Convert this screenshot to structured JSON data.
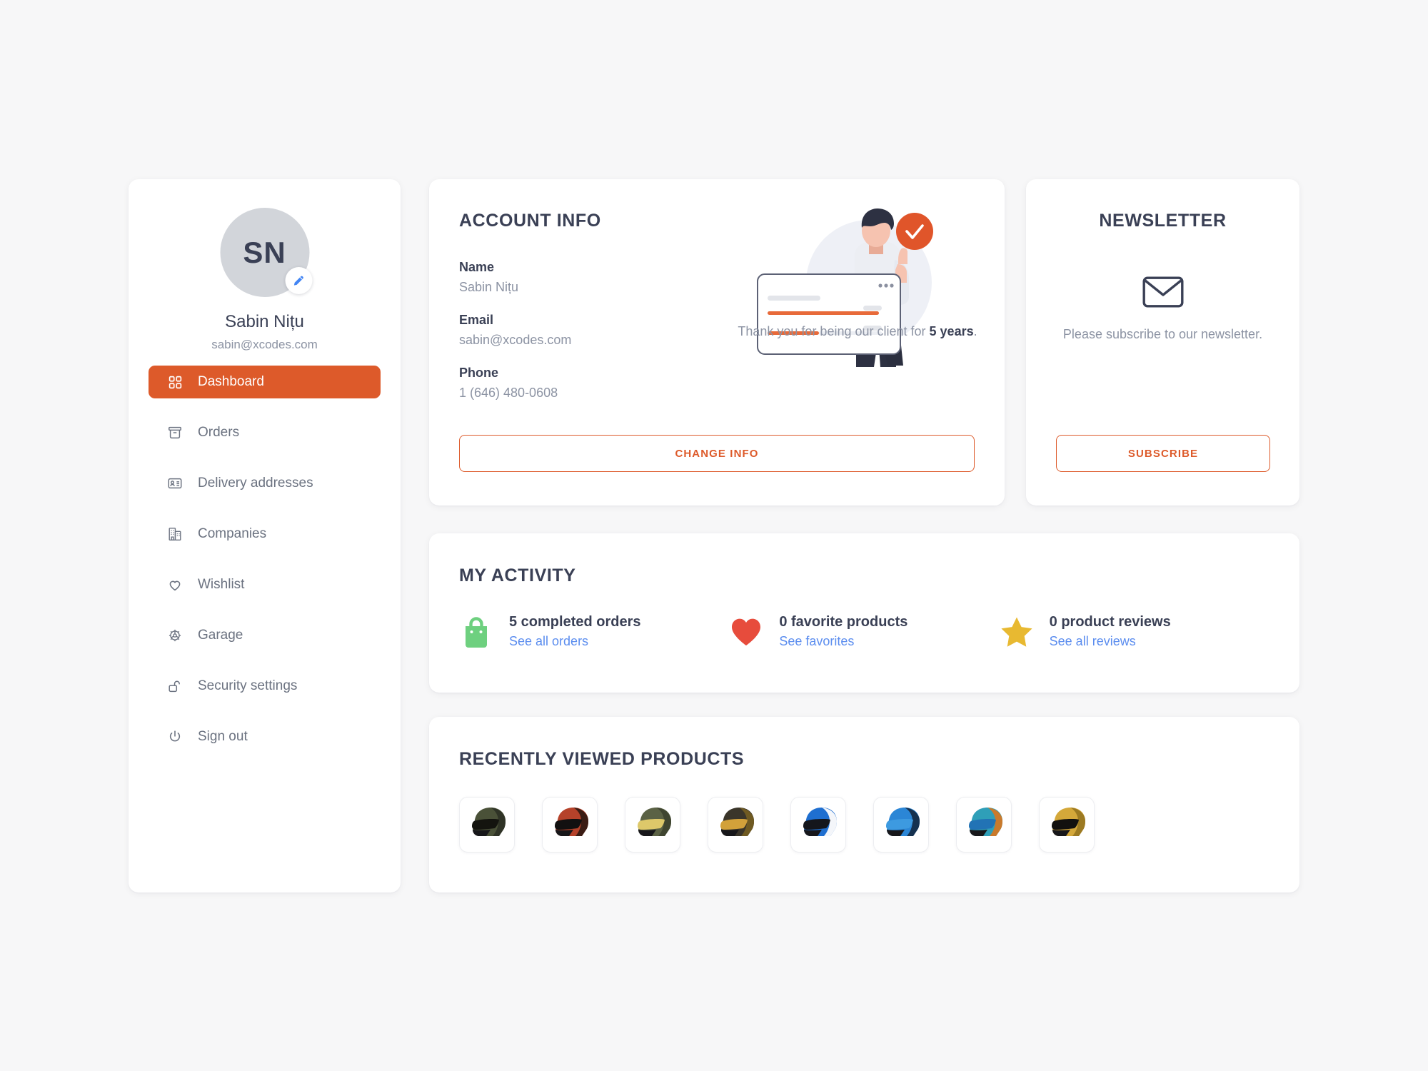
{
  "colors": {
    "accent": "#dd5a2a",
    "page_bg": "#f7f7f8",
    "card_bg": "#ffffff",
    "heading": "#3a4055",
    "muted": "#8c93a3",
    "link": "#5b8def",
    "avatar_bg": "#d2d5da",
    "edit_blue": "#4285f4",
    "bag_green": "#6ed07f",
    "heart_red": "#e74c3c",
    "star_yellow": "#e8b931"
  },
  "sidebar": {
    "avatar_initials": "SN",
    "edit_icon": "pencil-icon",
    "user_name": "Sabin Nițu",
    "user_email": "sabin@xcodes.com",
    "items": [
      {
        "label": "Dashboard",
        "icon": "grid-icon",
        "active": true
      },
      {
        "label": "Orders",
        "icon": "box-icon",
        "active": false
      },
      {
        "label": "Delivery addresses",
        "icon": "address-card-icon",
        "active": false
      },
      {
        "label": "Companies",
        "icon": "building-icon",
        "active": false
      },
      {
        "label": "Wishlist",
        "icon": "heart-outline-icon",
        "active": false
      },
      {
        "label": "Garage",
        "icon": "gear-icon",
        "active": false
      },
      {
        "label": "Security settings",
        "icon": "unlock-icon",
        "active": false
      },
      {
        "label": "Sign out",
        "icon": "power-icon",
        "active": false
      }
    ]
  },
  "account_info": {
    "title": "ACCOUNT INFO",
    "fields": [
      {
        "label": "Name",
        "value": "Sabin Nițu"
      },
      {
        "label": "Email",
        "value": "sabin@xcodes.com"
      },
      {
        "label": "Phone",
        "value": "1 (646) 480-0608"
      }
    ],
    "illustration": "person-thumbs-up-with-dashboard-illustration",
    "thanks_prefix": "Thank you for being our client for ",
    "thanks_highlight": "5 years",
    "thanks_suffix": ".",
    "button_label": "CHANGE INFO"
  },
  "newsletter": {
    "title": "NEWSLETTER",
    "icon": "envelope-icon",
    "text": "Please subscribe to our newsletter.",
    "button_label": "SUBSCRIBE"
  },
  "activity": {
    "title": "MY ACTIVITY",
    "items": [
      {
        "icon": "shopping-bag-icon",
        "count_label": "5 completed orders",
        "link_label": "See all orders"
      },
      {
        "icon": "heart-filled-icon",
        "count_label": "0 favorite products",
        "link_label": "See favorites"
      },
      {
        "icon": "star-icon",
        "count_label": "0 product reviews",
        "link_label": "See all reviews"
      }
    ]
  },
  "recently_viewed": {
    "title": "RECENTLY VIEWED PRODUCTS",
    "products": [
      {
        "name": "olive-black-graphic-helmet",
        "shell": "#4a5138",
        "shell2": "#2f3326",
        "visor": "#14140f"
      },
      {
        "name": "red-black-graphic-helmet",
        "shell": "#b5422a",
        "shell2": "#3a1c14",
        "visor": "#121010"
      },
      {
        "name": "olive-gold-visor-helmet",
        "shell": "#5b6245",
        "shell2": "#3f4530",
        "visor": "#ddc86a"
      },
      {
        "name": "gold-black-graphic-helmet",
        "shell": "#3a352a",
        "shell2": "#6f5a22",
        "visor": "#d2a13a"
      },
      {
        "name": "blue-white-red-race-helmet",
        "shell": "#1f6fd0",
        "shell2": "#f4f6fa",
        "visor": "#14161c"
      },
      {
        "name": "blue-black-graphic-helmet",
        "shell": "#2b86d6",
        "shell2": "#15314f",
        "visor": "#3d9ae0"
      },
      {
        "name": "teal-orange-art-helmet",
        "shell": "#2f9fb8",
        "shell2": "#c97a2c",
        "visor": "#2273b5"
      },
      {
        "name": "gold-black-helmet",
        "shell": "#d4a83a",
        "shell2": "#9c7a22",
        "visor": "#12110f"
      }
    ]
  }
}
